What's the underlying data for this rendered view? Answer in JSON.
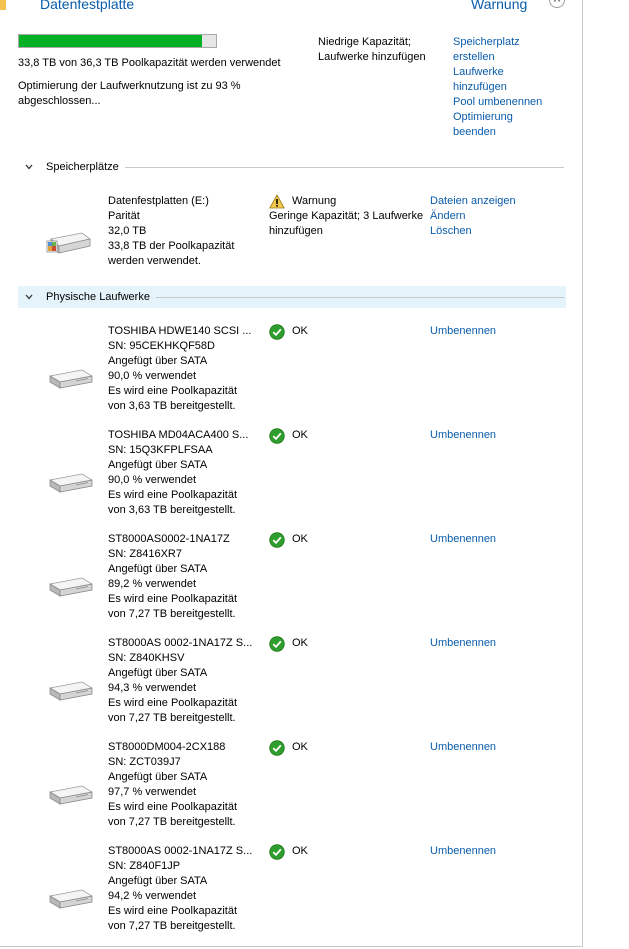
{
  "header": {
    "title": "Datenfestplatte",
    "status": "Warnung"
  },
  "pool": {
    "capacity_fraction": 0.931,
    "usage_text": "33,8 TB von 36,3 TB Poolkapazität werden verwendet",
    "optimization_text": [
      "Optimierung der Laufwerknutzung ist zu 93 %",
      "abgeschlossen..."
    ],
    "alert_text": [
      "Niedrige Kapazität;",
      "Laufwerke hinzufügen"
    ],
    "actions": [
      [
        "Speicherplatz",
        "erstellen"
      ],
      [
        "Laufwerke",
        "hinzufügen"
      ],
      [
        "Pool umbenennen"
      ],
      [
        "Optimierung",
        "beenden"
      ]
    ]
  },
  "spaces_section": {
    "label": "Speicherplätze",
    "space": {
      "name": "Datenfestplatten (E:)",
      "resiliency": "Parität",
      "size": "32,0 TB",
      "usage": [
        "33,8 TB der Poolkapazität",
        "werden verwendet."
      ],
      "status": "Warnung",
      "status_detail": [
        "Geringe Kapazität; 3 Laufwerke",
        "hinzufügen"
      ],
      "actions": [
        "Dateien anzeigen",
        "Ändern",
        "Löschen"
      ],
      "status_icon": "warning-icon"
    }
  },
  "drives_section": {
    "label": "Physische Laufwerke",
    "drives": [
      {
        "name": "TOSHIBA HDWE140 SCSI ...",
        "serial": "SN: 95CEKHKQF58D",
        "bus": "Angefügt über SATA",
        "used": "90,0 % verwendet",
        "provides": [
          "Es wird eine Poolkapazität",
          "von 3,63 TB bereitgestellt."
        ],
        "status": "OK",
        "action": "Umbenennen"
      },
      {
        "name": "TOSHIBA MD04ACA400 S...",
        "serial": "SN: 15Q3KFPLFSAA",
        "bus": "Angefügt über SATA",
        "used": "90,0 % verwendet",
        "provides": [
          "Es wird eine Poolkapazität",
          "von 3,63 TB bereitgestellt."
        ],
        "status": "OK",
        "action": "Umbenennen"
      },
      {
        "name": "ST8000AS0002-1NA17Z",
        "serial": "SN: Z8416XR7",
        "bus": "Angefügt über SATA",
        "used": "89,2 % verwendet",
        "provides": [
          "Es wird eine Poolkapazität",
          "von 7,27 TB bereitgestellt."
        ],
        "status": "OK",
        "action": "Umbenennen"
      },
      {
        "name": "ST8000AS 0002-1NA17Z S...",
        "serial": "SN: Z840KHSV",
        "bus": "Angefügt über SATA",
        "used": "94,3 % verwendet",
        "provides": [
          "Es wird eine Poolkapazität",
          "von 7,27 TB bereitgestellt."
        ],
        "status": "OK",
        "action": "Umbenennen"
      },
      {
        "name": "ST8000DM004-2CX188",
        "serial": "SN: ZCT039J7",
        "bus": "Angefügt über SATA",
        "used": "97,7 % verwendet",
        "provides": [
          "Es wird eine Poolkapazität",
          "von 7,27 TB bereitgestellt."
        ],
        "status": "OK",
        "action": "Umbenennen"
      },
      {
        "name": "ST8000AS 0002-1NA17Z S...",
        "serial": "SN: Z840F1JP",
        "bus": "Angefügt über SATA",
        "used": "94,2 % verwendet",
        "provides": [
          "Es wird eine Poolkapazität",
          "von 7,27 TB bereitgestellt."
        ],
        "status": "OK",
        "action": "Umbenennen"
      }
    ]
  },
  "colors": {
    "accent": "#0a5cab",
    "progress": "#06b025",
    "ok": "#2f9e2f",
    "warning": "#f2c94c",
    "selected_row": "#e5f3fb"
  }
}
